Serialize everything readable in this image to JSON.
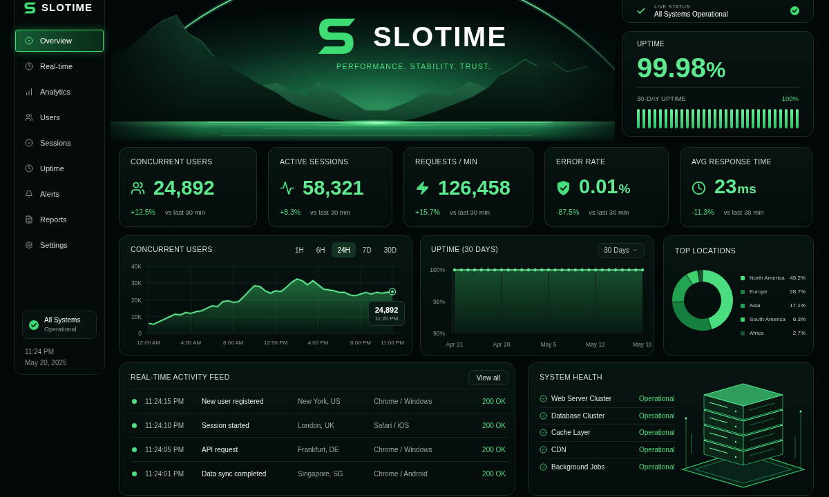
{
  "sidebar": {
    "brand": "SLOTIME",
    "items": [
      {
        "label": "Overview",
        "selected": true
      },
      {
        "label": "Real-time",
        "selected": false
      },
      {
        "label": "Analytics",
        "selected": false
      },
      {
        "label": "Users",
        "selected": false
      },
      {
        "label": "Sessions",
        "selected": false
      },
      {
        "label": "Uptime",
        "selected": false
      },
      {
        "label": "Alerts",
        "selected": false
      },
      {
        "label": "Reports",
        "selected": false
      },
      {
        "label": "Settings",
        "selected": false
      }
    ],
    "status": {
      "title": "All Systems",
      "subtitle": "Operational"
    },
    "time": "11:24 PM",
    "date": "May 20, 2025"
  },
  "hero": {
    "brand": "SLOTIME",
    "tagline": "PERFORMANCE. STABILITY. TRUST."
  },
  "live_status": {
    "label": "LIVE STATUS",
    "text": "All Systems Operational"
  },
  "uptime": {
    "label": "UPTIME",
    "value": "99.98",
    "unit": "%",
    "bars_label": "30-DAY UPTIME",
    "bars_reading": "100%"
  },
  "stats": [
    {
      "label": "CONCURRENT USERS",
      "value": "24,892",
      "change": "+12.5%",
      "period": "vs last 30 min"
    },
    {
      "label": "ACTIVE SESSIONS",
      "value": "58,321",
      "change": "+8.3%",
      "period": "vs last 30 min"
    },
    {
      "label": "REQUESTS / MIN",
      "value": "126,458",
      "change": "+15.7%",
      "period": "vs last 30 min"
    },
    {
      "label": "ERROR RATE",
      "value": "0.01",
      "unit": "%",
      "change": "-87.5%",
      "period": "vs last 30 min"
    },
    {
      "label": "AVG RESPONSE TIME",
      "value": "23",
      "unit": "ms",
      "change": "-11.3%",
      "period": "vs last 30 min"
    }
  ],
  "concurrent_users": {
    "title": "CONCURRENT USERS",
    "ranges": [
      {
        "label": "1H",
        "selected": false
      },
      {
        "label": "6H",
        "selected": false
      },
      {
        "label": "24H",
        "selected": true
      },
      {
        "label": "7D",
        "selected": false
      },
      {
        "label": "30D",
        "selected": false
      }
    ],
    "tooltip": {
      "value": "24,892",
      "time": "11:20 PM"
    },
    "chart_data": {
      "type": "area",
      "grid": true,
      "x": [
        0,
        0.5,
        1,
        1.5,
        2,
        2.5,
        3,
        3.5,
        4,
        4.5,
        5,
        5.5,
        6,
        6.5,
        7,
        7.5,
        8,
        8.5,
        9,
        9.5,
        10,
        10.5,
        11,
        11.5,
        12,
        12.5,
        13,
        13.5,
        14,
        14.5,
        15,
        15.5,
        16,
        16.5,
        17,
        17.5,
        18,
        18.5,
        19,
        19.5,
        20,
        20.5,
        21,
        21.5,
        22,
        22.5,
        23
      ],
      "values": [
        6000,
        5500,
        7000,
        8500,
        10000,
        11500,
        11000,
        12500,
        12000,
        13000,
        13500,
        15000,
        16500,
        16000,
        19000,
        19500,
        18500,
        19000,
        22000,
        25500,
        28500,
        28000,
        25500,
        24000,
        25500,
        25000,
        27500,
        30500,
        32500,
        31500,
        29000,
        31500,
        29000,
        26500,
        26000,
        25500,
        24500,
        24500,
        23000,
        22500,
        23500,
        24500,
        23500,
        24500,
        24000,
        24500,
        25000
      ],
      "xlim": [
        0,
        23
      ],
      "ylim": [
        0,
        40000
      ],
      "xticks": [
        {
          "value": 0,
          "label": "12:00 AM"
        },
        {
          "value": 4,
          "label": "4:00 AM"
        },
        {
          "value": 8,
          "label": "8:00 AM"
        },
        {
          "value": 12,
          "label": "12:00 PM"
        },
        {
          "value": 16,
          "label": "4:00 PM"
        },
        {
          "value": 20,
          "label": "8:00 PM"
        },
        {
          "value": 23,
          "label": "11:00 PM"
        }
      ],
      "yticks": [
        {
          "value": 0,
          "label": "0"
        },
        {
          "value": 10000,
          "label": "10K"
        },
        {
          "value": 20000,
          "label": "20K"
        },
        {
          "value": 30000,
          "label": "30K"
        },
        {
          "value": 40000,
          "label": "40K"
        }
      ]
    }
  },
  "uptime_chart": {
    "title": "UPTIME (30 DAYS)",
    "range": "30 Days",
    "chart_data": {
      "type": "line",
      "grid": true,
      "categories": [
        "Apr 21",
        null,
        null,
        null,
        null,
        null,
        null,
        "Apr 28",
        null,
        null,
        null,
        null,
        null,
        null,
        "May 5",
        null,
        null,
        null,
        null,
        null,
        null,
        "May 12",
        null,
        null,
        null,
        null,
        null,
        null,
        "May 19"
      ],
      "values": [
        100,
        100,
        100,
        100,
        100,
        100,
        100,
        100,
        100,
        100,
        100,
        100,
        100,
        100,
        100,
        100,
        100,
        100,
        100,
        100,
        100,
        100,
        100,
        100,
        100,
        100,
        100,
        100,
        100
      ],
      "ylim": [
        90,
        100
      ],
      "yticks": [
        {
          "value": 90,
          "label": "90%"
        },
        {
          "value": 95,
          "label": "95%"
        },
        {
          "value": 100,
          "label": "100%"
        }
      ]
    }
  },
  "top_locations": {
    "title": "TOP LOCATIONS",
    "legend": [
      {
        "label": "North America",
        "share": "45.2%",
        "color": "#4ade80"
      },
      {
        "label": "Europe",
        "share": "28.7%",
        "color": "#15803d"
      },
      {
        "label": "Asia",
        "share": "17.1%",
        "color": "#22a34f"
      },
      {
        "label": "South America",
        "share": "6.3%",
        "color": "#3fcf6f"
      },
      {
        "label": "Africa",
        "share": "2.7%",
        "color": "#14532d"
      }
    ],
    "chart_data": {
      "type": "donut",
      "values": [
        45.2,
        28.7,
        17.1,
        6.3,
        2.7
      ]
    }
  },
  "activity_feed": {
    "title": "REAL-TIME ACTIVITY FEED",
    "button": "View all",
    "rows": [
      {
        "time": "11:24:15 PM",
        "event": "New user registered",
        "location": "New York, US",
        "client": "Chrome / Windows",
        "status": "200 OK"
      },
      {
        "time": "11:24:10 PM",
        "event": "Session started",
        "location": "London, UK",
        "client": "Safari / iOS",
        "status": "200 OK"
      },
      {
        "time": "11:24:05 PM",
        "event": "API request",
        "location": "Frankfurt, DE",
        "client": "Chrome / Windows",
        "status": "200 OK"
      },
      {
        "time": "11:24:01 PM",
        "event": "Data sync completed",
        "location": "Singapore, SG",
        "client": "Chrome / Android",
        "status": "200 OK"
      }
    ]
  },
  "system_health": {
    "title": "SYSTEM HEALTH",
    "items": [
      {
        "name": "Web Server Cluster",
        "status": "Operational"
      },
      {
        "name": "Database Cluster",
        "status": "Operational"
      },
      {
        "name": "Cache Layer",
        "status": "Operational"
      },
      {
        "name": "CDN",
        "status": "Operational"
      },
      {
        "name": "Background Jobs",
        "status": "Operational"
      }
    ]
  }
}
